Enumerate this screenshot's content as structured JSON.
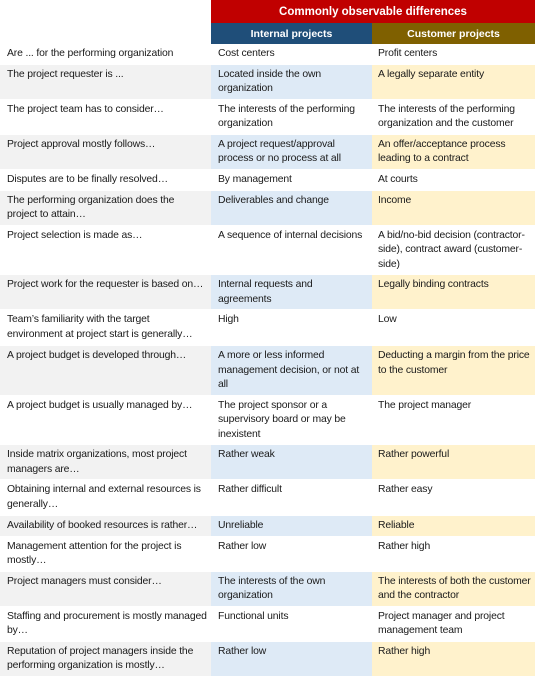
{
  "header": {
    "title": "Commonly observable differences",
    "internal_label": "Internal projects",
    "customer_label": "Customer projects",
    "colors": {
      "title_bg": "#c00000",
      "internal_bg": "#1f4e79",
      "customer_bg": "#7f6000",
      "label_shade": "#f2f2f2",
      "internal_shade": "#deeaf6",
      "customer_shade": "#fff2cc"
    }
  },
  "rows": [
    {
      "label": "Are ... for the performing organization",
      "internal": "Cost centers",
      "customer": "Profit centers"
    },
    {
      "label": "The project requester is ...",
      "internal": "Located inside the own organization",
      "customer": "A legally separate entity"
    },
    {
      "label": "The project team has to consider…",
      "internal": "The interests of the performing organization",
      "customer": "The interests of the performing organization and the customer"
    },
    {
      "label": "Project approval mostly follows…",
      "internal": "A project request/approval process or no process at all",
      "customer": "An offer/acceptance process leading to a contract"
    },
    {
      "label": "Disputes are to be finally resolved…",
      "internal": "By management",
      "customer": "At courts"
    },
    {
      "label": "The performing organization does the project to attain…",
      "internal": "Deliverables and change",
      "customer": "Income"
    },
    {
      "label": "Project selection is made as…",
      "internal": "A sequence of internal decisions",
      "customer": "A bid/no-bid decision (contractor-side), contract award (customer-side)"
    },
    {
      "label": "Project work for the requester is based on…",
      "internal": "Internal requests and agreements",
      "customer": "Legally binding contracts"
    },
    {
      "label": "Team’s familiarity with the target environment at project start is generally…",
      "internal": "High",
      "customer": "Low"
    },
    {
      "label": "A project budget is developed through…",
      "internal": "A more or less informed management decision, or not at all",
      "customer": "Deducting a margin from the price to the customer"
    },
    {
      "label": "A project budget is usually managed by…",
      "internal": "The project sponsor or a supervisory board or may be inexistent",
      "customer": "The project manager"
    },
    {
      "label": "Inside matrix organizations, most project managers are…",
      "internal": "Rather weak",
      "customer": "Rather powerful"
    },
    {
      "label": "Obtaining internal and external resources is generally…",
      "internal": "Rather difficult",
      "customer": "Rather easy"
    },
    {
      "label": "Availability of booked resources is rather…",
      "internal": "Unreliable",
      "customer": "Reliable"
    },
    {
      "label": "Management attention for the project is mostly…",
      "internal": "Rather low",
      "customer": "Rather high"
    },
    {
      "label": "Project managers must consider…",
      "internal": "The interests of the own organization",
      "customer": "The interests of both the customer and the contractor"
    },
    {
      "label": "Staffing and procurement is mostly managed by…",
      "internal": "Functional units",
      "customer": "Project manager and project management team"
    },
    {
      "label": "Reputation of project managers inside the performing organization is mostly…",
      "internal": "Rather low",
      "customer": "Rather high"
    }
  ]
}
